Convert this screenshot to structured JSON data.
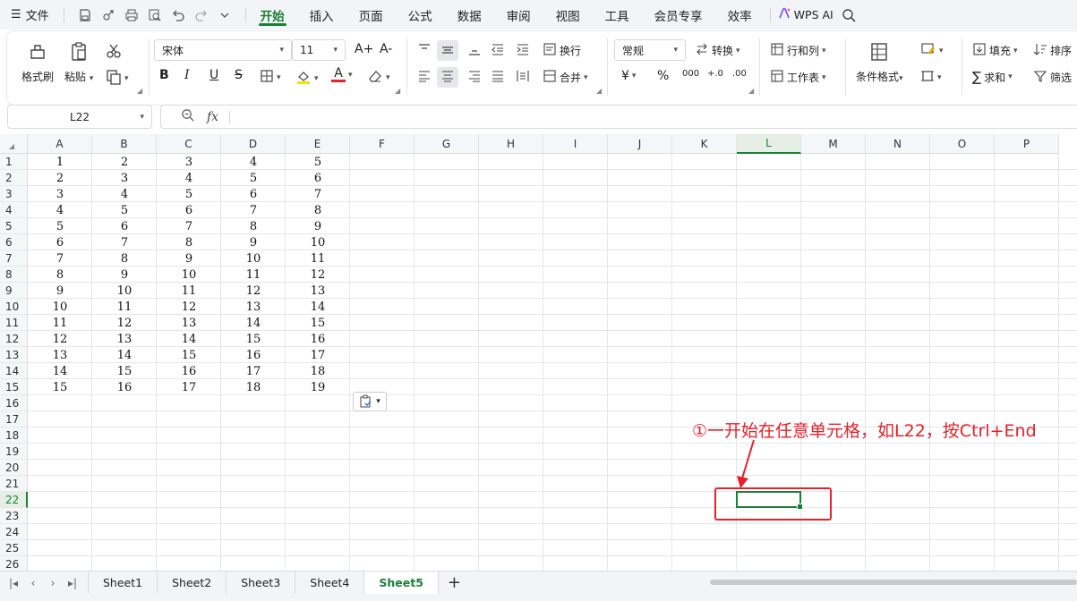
{
  "menubar": {
    "file_label": "文件",
    "tabs": [
      "开始",
      "插入",
      "页面",
      "公式",
      "数据",
      "审阅",
      "视图",
      "工具",
      "会员专享",
      "效率"
    ],
    "active_tab": "开始",
    "ai_label": "WPS AI"
  },
  "ribbon": {
    "format_painter": "格式刷",
    "paste": "粘贴",
    "font_name": "宋体",
    "font_size": "11",
    "wrap": "换行",
    "merge": "合并",
    "number_format": "常规",
    "convert": "转换",
    "row_col": "行和列",
    "worksheet": "工作表",
    "cond_format": "条件格式",
    "fill": "填充",
    "sort": "排序",
    "sum": "求和",
    "filter": "筛选",
    "bold": "B",
    "italic": "I",
    "underline": "U",
    "strike": "S",
    "increase_font": "A+",
    "decrease_font": "A-",
    "font_color_letter": "A",
    "currency": "¥",
    "percent": "%",
    "thousands": "000",
    "inc_decimal": "+.0",
    "dec_decimal": ".00"
  },
  "formula_bar": {
    "name_box": "L22",
    "fx_label": "fx",
    "formula": ""
  },
  "columns": [
    "A",
    "B",
    "C",
    "D",
    "E",
    "F",
    "G",
    "H",
    "I",
    "J",
    "K",
    "L",
    "M",
    "N",
    "O",
    "P"
  ],
  "selected_column": "L",
  "rows": [
    "1",
    "2",
    "3",
    "4",
    "5",
    "6",
    "7",
    "8",
    "9",
    "10",
    "11",
    "12",
    "13",
    "14",
    "15",
    "16",
    "17",
    "18",
    "19",
    "20",
    "21",
    "22",
    "23",
    "24",
    "25",
    "26"
  ],
  "selected_row": "22",
  "cells": [
    [
      "1",
      "2",
      "3",
      "4",
      "5"
    ],
    [
      "2",
      "3",
      "4",
      "5",
      "6"
    ],
    [
      "3",
      "4",
      "5",
      "6",
      "7"
    ],
    [
      "4",
      "5",
      "6",
      "7",
      "8"
    ],
    [
      "5",
      "6",
      "7",
      "8",
      "9"
    ],
    [
      "6",
      "7",
      "8",
      "9",
      "10"
    ],
    [
      "7",
      "8",
      "9",
      "10",
      "11"
    ],
    [
      "8",
      "9",
      "10",
      "11",
      "12"
    ],
    [
      "9",
      "10",
      "11",
      "12",
      "13"
    ],
    [
      "10",
      "11",
      "12",
      "13",
      "14"
    ],
    [
      "11",
      "12",
      "13",
      "14",
      "15"
    ],
    [
      "12",
      "13",
      "14",
      "15",
      "16"
    ],
    [
      "13",
      "14",
      "15",
      "16",
      "17"
    ],
    [
      "14",
      "15",
      "16",
      "17",
      "18"
    ],
    [
      "15",
      "16",
      "17",
      "18",
      "19"
    ]
  ],
  "annotation": {
    "text": "①一开始在任意单元格，如L22，按Ctrl+End",
    "color": "#e8202a"
  },
  "sheet_tabs": [
    "Sheet1",
    "Sheet2",
    "Sheet3",
    "Sheet4",
    "Sheet5"
  ],
  "active_sheet": "Sheet5",
  "add_sheet": "+",
  "colors": {
    "accent": "#1a7f37",
    "annotation": "#e8202a"
  }
}
